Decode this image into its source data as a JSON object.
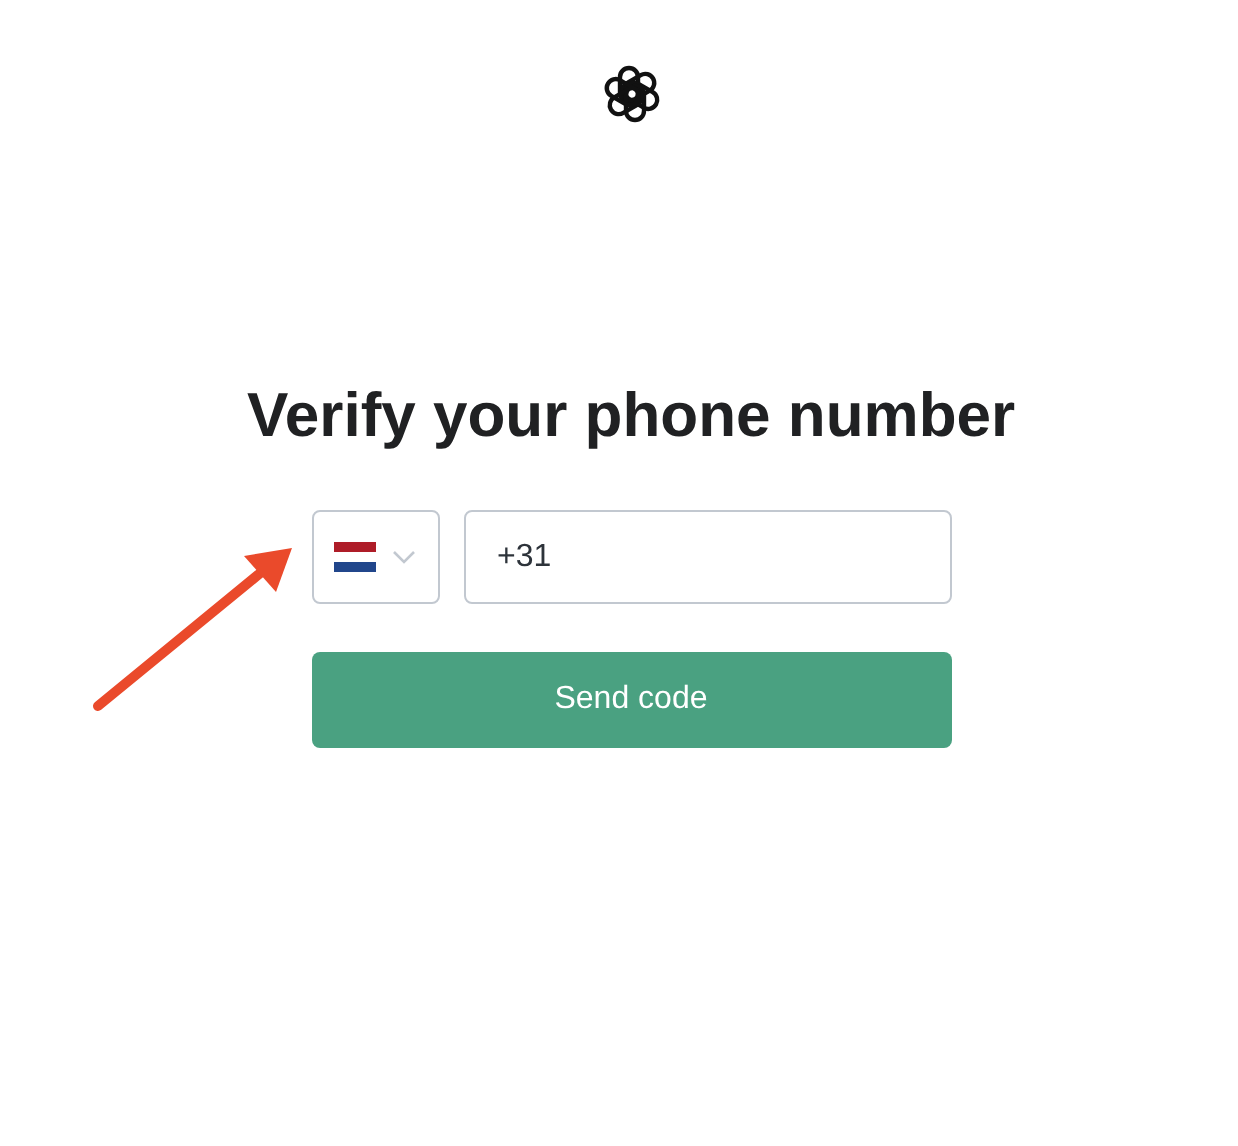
{
  "heading": "Verify your phone number",
  "phone_field": {
    "value": "+31"
  },
  "send_button": {
    "label": "Send code"
  }
}
